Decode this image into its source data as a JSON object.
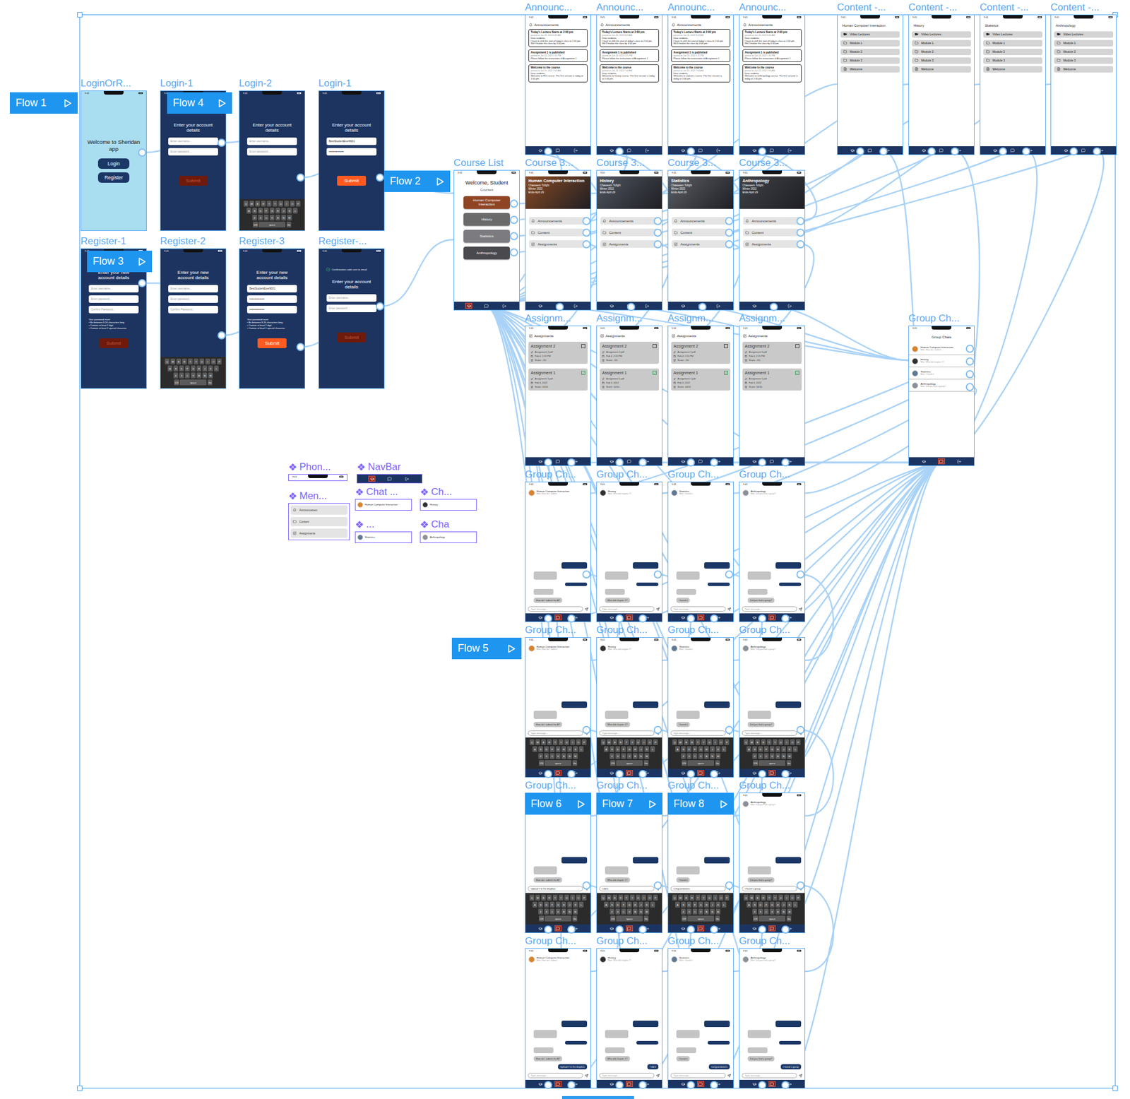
{
  "status_time": "9:41",
  "component_icon": "❖",
  "keyboard": {
    "rows": [
      [
        "Q",
        "W",
        "E",
        "R",
        "T",
        "Y",
        "U",
        "I",
        "O",
        "P"
      ],
      [
        "A",
        "S",
        "D",
        "F",
        "G",
        "H",
        "J",
        "K",
        "L"
      ],
      [
        "Z",
        "X",
        "C",
        "V",
        "B",
        "N",
        "M"
      ]
    ],
    "bottom": [
      "123",
      "space",
      "Go"
    ]
  },
  "login": [
    {
      "label": "LoginOrR...",
      "kind": "welcome",
      "title": "Welcome to Sheridan app",
      "buttons": [
        "Login",
        "Register"
      ]
    },
    {
      "label": "Login-1",
      "kind": "form",
      "note": null,
      "title": "Enter your account details",
      "fields": [
        {
          "text": "Enter username...",
          "filled": false
        },
        {
          "text": "Enter password...",
          "filled": false
        }
      ],
      "rules": null,
      "submit": {
        "label": "Submit",
        "enabled": false
      },
      "keyboard": false
    },
    {
      "label": "Login-2",
      "kind": "form",
      "note": null,
      "title": "Enter your account details",
      "fields": [
        {
          "text": "Enter username...",
          "filled": false
        },
        {
          "text": "Enter password...",
          "filled": false
        }
      ],
      "rules": null,
      "submit": null,
      "keyboard": true
    },
    {
      "label": "Login-1",
      "kind": "form",
      "note": null,
      "title": "Enter your account details",
      "fields": [
        {
          "text": "BestStudentEver9001",
          "filled": true
        },
        {
          "text": "••••••••••••••••",
          "filled": true
        }
      ],
      "rules": null,
      "submit": {
        "label": "Submit",
        "enabled": true
      },
      "keyboard": false
    }
  ],
  "register": [
    {
      "label": "Register-1",
      "kind": "form",
      "note": null,
      "title": "Enter your new account details",
      "fields": [
        {
          "text": "Enter username...",
          "filled": false
        },
        {
          "text": "Enter password...",
          "filled": false
        },
        {
          "text": "Confirm Password...",
          "filled": false
        }
      ],
      "rules": {
        "title": "Your password must:",
        "items": [
          "Be between 8-16 characters long",
          "Contain at least 1 digit",
          "Contain at least 1 special character"
        ]
      },
      "submit": {
        "label": "Submit",
        "enabled": false
      },
      "keyboard": false
    },
    {
      "label": "Register-2",
      "kind": "form",
      "note": null,
      "title": "Enter your new account details",
      "fields": [
        {
          "text": "Enter username...",
          "filled": false
        },
        {
          "text": "Enter password...",
          "filled": false
        },
        {
          "text": "Confirm Password...",
          "filled": false
        }
      ],
      "rules": null,
      "submit": null,
      "keyboard": true
    },
    {
      "label": "Register-3",
      "kind": "form",
      "note": null,
      "title": "Enter your new account details",
      "fields": [
        {
          "text": "BestStudentEver9001",
          "filled": true
        },
        {
          "text": "••••••••••••••••",
          "filled": true
        },
        {
          "text": "••••••••••••••••",
          "filled": true
        }
      ],
      "rules": {
        "title": "Your password must:",
        "items": [
          "Be between 8-16 characters long",
          "Contain at least 1 digit",
          "Contain at least 1 special character"
        ]
      },
      "submit": {
        "label": "Submit",
        "enabled": true
      },
      "keyboard": false
    },
    {
      "label": "Register-...",
      "kind": "form",
      "note": "Confirmation code sent to email",
      "title": "Enter your account details",
      "fields": [
        {
          "text": "Enter username...",
          "filled": false
        },
        {
          "text": "Enter password...",
          "filled": false
        }
      ],
      "rules": null,
      "submit": {
        "label": "Submit",
        "enabled": false
      },
      "keyboard": false
    }
  ],
  "course_list": {
    "label": "Course List",
    "title": "Welcome, Student",
    "subtitle": "Courses",
    "nav_selected": "courses",
    "courses": [
      {
        "name": "Human Computer Interaction",
        "color": "#8f4524"
      },
      {
        "name": "History",
        "color": "#6a6a6a"
      },
      {
        "name": "Statistics",
        "color": "#7b7b80"
      },
      {
        "name": "Anthropology",
        "color": "#4a4a4e"
      }
    ]
  },
  "courses": [
    {
      "label": "Course 3...",
      "title": "Human Computer Interaction",
      "teacher": "Chasseem Tofighi",
      "term": "Winter 2022",
      "ends": "Ends April 29",
      "color": "#8a4a22",
      "menu": [
        "Announcements",
        "Content",
        "Assignments"
      ]
    },
    {
      "label": "Course 3...",
      "title": "History",
      "teacher": "Chasseem Tofighi",
      "term": "Winter 2022",
      "ends": "Ends April 29",
      "color": "#4f5560",
      "menu": [
        "Announcements",
        "Content",
        "Assignments"
      ]
    },
    {
      "label": "Course 3...",
      "title": "Statistics",
      "teacher": "Chasseem Tofighi",
      "term": "Winter 2022",
      "ends": "Ends April 29",
      "color": "#5c5f66",
      "menu": [
        "Announcements",
        "Content",
        "Assignments"
      ]
    },
    {
      "label": "Course 3...",
      "title": "Anthropology",
      "teacher": "Chasseem Tofighi",
      "term": "Winter 2022",
      "ends": "Ends April 29",
      "color": "#3e4248",
      "menu": [
        "Announcements",
        "Content",
        "Assignments"
      ]
    }
  ],
  "announcements": [
    {
      "label": "Announc...",
      "title": "Announcements",
      "cards": [
        {
          "title": "Today's Lecture Starts at 2:00 pm",
          "date": "posted on Jan 26, 2022 8:42 AM",
          "body": "Dear students,\nI have to shift the start of today's class to 2:00 pm. We'll finalize the class by 4:00 pm."
        },
        {
          "title": "Assignment 1 is published",
          "date": "posted on Jan 24, 2022 1:15 PM",
          "body": "Please follow the instructions of Assignment 1"
        },
        {
          "title": "Welcome to the course",
          "date": "posted on Jan 20, 2022 7:00 AM",
          "body": "Dear students,\nWelcome to HCI course. The first session is today at 1:00 pm."
        }
      ]
    },
    {
      "label": "Announc...",
      "title": "Announcements",
      "cards": [
        {
          "title": "Today's Lecture Starts at 2:00 pm",
          "date": "posted on Jan 26, 2022 8:42 AM",
          "body": "Dear students,\nI have to shift the start of today's class to 2:00 pm. We'll finalize the class by 4:00 pm."
        },
        {
          "title": "Assignment 1 is published",
          "date": "posted on Jan 24, 2022 1:15 PM",
          "body": "Please follow the instructions of Assignment 1"
        },
        {
          "title": "Welcome to the course",
          "date": "posted on Jan 20, 2022 7:00 AM",
          "body": "Dear students,\nWelcome to history course. The first session is today at 1:00 pm."
        }
      ]
    },
    {
      "label": "Announc...",
      "title": "Announcements",
      "cards": [
        {
          "title": "Today's Lecture Starts at 2:00 pm",
          "date": "posted on Jan 26, 2022 8:42 AM",
          "body": "Dear students,\nI have to shift the start of today's class to 2:00 pm. We'll finalize the class by 4:00 pm."
        },
        {
          "title": "Assignment 1 is published",
          "date": "posted on Jan 24, 2022 1:15 PM",
          "body": "Please follow the instructions of Assignment 1"
        },
        {
          "title": "Welcome to the course",
          "date": "posted on Jan 20, 2022 7:00 AM",
          "body": "Dear students,\nWelcome to statistics course. The first session is today at 1:00 pm."
        }
      ]
    },
    {
      "label": "Announc...",
      "title": "Announcements",
      "cards": [
        {
          "title": "Today's Lecture Starts at 2:00 pm",
          "date": "posted on Jan 26, 2022 8:42 AM",
          "body": "Dear students,\nI have to shift the start of today's class to 2:00 pm. We'll finalize the class by 4:00 pm."
        },
        {
          "title": "Assignment 1 is published",
          "date": "posted on Jan 24, 2022 1:15 PM",
          "body": "Please follow the instructions of Assignment 1"
        },
        {
          "title": "Welcome to the course",
          "date": "posted on Jan 20, 2022 7:00 AM",
          "body": "Dear students,\nWelcome to anthropology course. The first session is today at 1:00 pm."
        }
      ]
    }
  ],
  "contents": [
    {
      "label": "Content -...",
      "title": "Human Computer Interaction",
      "items": [
        {
          "text": "Video Lectures",
          "kind": "video"
        },
        {
          "text": "Module 1",
          "kind": "folder"
        },
        {
          "text": "Module 2",
          "kind": "folder"
        },
        {
          "text": "Module 3",
          "kind": "folder"
        },
        {
          "text": "Welcome",
          "kind": "file"
        }
      ]
    },
    {
      "label": "Content -...",
      "title": "History",
      "items": [
        {
          "text": "Video Lectures",
          "kind": "video"
        },
        {
          "text": "Module 1",
          "kind": "folder"
        },
        {
          "text": "Module 2",
          "kind": "folder"
        },
        {
          "text": "Module 3",
          "kind": "folder"
        },
        {
          "text": "Welcome",
          "kind": "file"
        }
      ]
    },
    {
      "label": "Content -...",
      "title": "Statistics",
      "items": [
        {
          "text": "Video Lectures",
          "kind": "video"
        },
        {
          "text": "Module 1",
          "kind": "folder"
        },
        {
          "text": "Module 2",
          "kind": "folder"
        },
        {
          "text": "Module 3",
          "kind": "folder"
        },
        {
          "text": "Welcome",
          "kind": "file"
        }
      ]
    },
    {
      "label": "Content -...",
      "title": "Anthropology",
      "items": [
        {
          "text": "Video Lectures",
          "kind": "video"
        },
        {
          "text": "Module 1",
          "kind": "folder"
        },
        {
          "text": "Module 2",
          "kind": "folder"
        },
        {
          "text": "Module 3",
          "kind": "folder"
        },
        {
          "text": "Welcome",
          "kind": "file"
        }
      ]
    }
  ],
  "assignments": [
    {
      "label": "Assignm...",
      "title": "Assignments",
      "items": [
        {
          "name": "Assignment 2",
          "checked": false,
          "file": "Assignment 2.pdf",
          "due": "Feb 4, 2:15 PM",
          "score": "Score: -/10"
        },
        {
          "name": "Assignment 1",
          "checked": true,
          "file": "Assignment 1.pdf",
          "due": "Feb 3, 2022",
          "score": "Score: 10/10"
        }
      ]
    },
    {
      "label": "Assignm...",
      "title": "Assignments",
      "items": [
        {
          "name": "Assignment 2",
          "checked": false,
          "file": "Assignment 2.pdf",
          "due": "Feb 4, 2:15 PM",
          "score": "Score: -/10"
        },
        {
          "name": "Assignment 1",
          "checked": true,
          "file": "Assignment 1.pdf",
          "due": "Feb 3, 2022",
          "score": "Score: 10/10"
        }
      ]
    },
    {
      "label": "Assignm...",
      "title": "Assignments",
      "items": [
        {
          "name": "Assignment 2",
          "checked": false,
          "file": "Assignment 2.pdf",
          "due": "Feb 4, 2:15 PM",
          "score": "Score: -/10"
        },
        {
          "name": "Assignment 1",
          "checked": true,
          "file": "Assignment 1.pdf",
          "due": "Feb 3, 2022",
          "score": "Score: 10/10"
        }
      ]
    },
    {
      "label": "Assignm...",
      "title": "Assignments",
      "items": [
        {
          "name": "Assignment 2",
          "checked": false,
          "file": "Assignment 2.pdf",
          "due": "Feb 4, 2:15 PM",
          "score": "Score: -/10"
        },
        {
          "name": "Assignment 1",
          "checked": true,
          "file": "Assignment 1.pdf",
          "due": "Feb 3, 2022",
          "score": "Score: 10/10"
        }
      ]
    }
  ],
  "chat_rows": [
    [
      {
        "label": "Group Ch...",
        "course": "Human Computer Interaction",
        "preview": "Mon: How do I submit...",
        "color": "#d9822b",
        "question": "How do I submit the A?",
        "input": "Type message...",
        "input_filled": false,
        "sent": null,
        "keyboard": false
      },
      {
        "label": "Group Ch...",
        "course": "History",
        "preview": "Mon: Who did chapter 1?",
        "color": "#2f2f2f",
        "question": "Who did chapter 1?",
        "input": "Type message...",
        "input_filled": false,
        "sent": null,
        "keyboard": false
      },
      {
        "label": "Group Ch...",
        "course": "Statistics",
        "preview": "Mon: I found it",
        "color": "#5f7896",
        "question": "I found it",
        "input": "Type message...",
        "input_filled": false,
        "sent": null,
        "keyboard": false
      },
      {
        "label": "Group Ch...",
        "course": "Anthropology",
        "preview": "Mon: Did you find a group?",
        "color": "#8a9098",
        "question": "Did you find a group?",
        "input": "Type message...",
        "input_filled": false,
        "sent": null,
        "keyboard": false
      }
    ],
    [
      {
        "label": "Group Ch...",
        "course": "Human Computer Interaction",
        "preview": "Mon: How do I submit...",
        "color": "#d9822b",
        "question": "How do I submit the A?",
        "input": "Type message...",
        "input_filled": false,
        "sent": null,
        "keyboard": true
      },
      {
        "label": "Group Ch...",
        "course": "History",
        "preview": "Mon: Who did chapter 1?",
        "color": "#2f2f2f",
        "question": "Who did chapter 1?",
        "input": "Type message...",
        "input_filled": false,
        "sent": null,
        "keyboard": true
      },
      {
        "label": "Group Ch...",
        "course": "Statistics",
        "preview": "Mon: I found it",
        "color": "#5f7896",
        "question": "I found it",
        "input": "Type message...",
        "input_filled": false,
        "sent": null,
        "keyboard": true
      },
      {
        "label": "Group Ch...",
        "course": "Anthropology",
        "preview": "Mon: Did you find a group?",
        "color": "#8a9098",
        "question": "Did you find a group?",
        "input": "Type message...",
        "input_filled": false,
        "sent": null,
        "keyboard": true
      }
    ],
    [
      {
        "label": "Group Ch...",
        "course": "Human Computer Interaction",
        "preview": "Mon: How do I submit...",
        "color": "#d9822b",
        "question": "How do I submit the A?",
        "input": "Upload it to the dropbox",
        "input_filled": true,
        "sent": null,
        "keyboard": true
      },
      {
        "label": "Group Ch...",
        "course": "History",
        "preview": "Mon: Who did chapter 1?",
        "color": "#2f2f2f",
        "question": "Who did chapter 1?",
        "input": "I did it",
        "input_filled": true,
        "sent": null,
        "keyboard": true
      },
      {
        "label": "Group Ch...",
        "course": "Statistics",
        "preview": "Mon: I found it",
        "color": "#5f7896",
        "question": "I found it",
        "input": "Congratulations",
        "input_filled": true,
        "sent": null,
        "keyboard": true
      },
      {
        "label": "Group Ch...",
        "course": "Anthropology",
        "preview": "Mon: Did you find a group?",
        "color": "#8a9098",
        "question": "Did you find a group?",
        "input": "I found a group",
        "input_filled": true,
        "sent": null,
        "keyboard": true
      }
    ],
    [
      {
        "label": "Group Ch...",
        "course": "Human Computer Interaction",
        "preview": "Mon: How do I submit...",
        "color": "#d9822b",
        "question": "How do I submit the A?",
        "input": "Type message...",
        "input_filled": false,
        "sent": "Upload it to the dropbox",
        "keyboard": false
      },
      {
        "label": "Group Ch...",
        "course": "History",
        "preview": "Mon: Who did chapter 1?",
        "color": "#2f2f2f",
        "question": "Who did chapter 1?",
        "input": "Type message...",
        "input_filled": false,
        "sent": "I did it",
        "keyboard": false
      },
      {
        "label": "Group Ch...",
        "course": "Statistics",
        "preview": "Mon: I found it",
        "color": "#5f7896",
        "question": "I found it",
        "input": "Type message...",
        "input_filled": false,
        "sent": "Congratulations",
        "keyboard": false
      },
      {
        "label": "Group Ch...",
        "course": "Anthropology",
        "preview": "Mon: Did you find a group?",
        "color": "#8a9098",
        "question": "Did you find a group?",
        "input": "Type message...",
        "input_filled": false,
        "sent": "I found a group",
        "keyboard": false
      }
    ]
  ],
  "chat_list": {
    "label": "Group Ch...",
    "title": "Group Chats",
    "nav_selected": "chats",
    "items": [
      {
        "name": "Human Computer Interaction",
        "preview": "Mon: How do I submit...",
        "color": "#d9822b"
      },
      {
        "name": "History",
        "preview": "Mon: Who did chapter 1?",
        "color": "#2f2f2f"
      },
      {
        "name": "Statistics",
        "preview": "Mon: I found it",
        "color": "#5f7896"
      },
      {
        "name": "Anthropology",
        "preview": "Mon: Did you find a group?",
        "color": "#8a9098"
      }
    ]
  },
  "components": [
    {
      "label": "Phon...",
      "kind": "phone-bar"
    },
    {
      "label": "NavBar",
      "kind": "navbar"
    },
    {
      "label": "Men...",
      "kind": "menu",
      "items": [
        "Announcemen",
        "Content",
        "Assignments"
      ]
    },
    {
      "label": "Chat ...",
      "kind": "chat-item",
      "name": "Human Computer Interaction",
      "color": "#d9822b"
    },
    {
      "label": "Ch...",
      "kind": "chat-item",
      "name": "History",
      "color": "#2f2f2f"
    },
    {
      "label": "...",
      "kind": "chat-item",
      "name": "Statistics",
      "color": "#5f7896"
    },
    {
      "label": "Cha",
      "kind": "chat-item",
      "name": "Anthropology",
      "color": "#8a9098"
    }
  ],
  "flows": [
    {
      "label": "Flow 1"
    },
    {
      "label": "Flow 4"
    },
    {
      "label": "Flow 3"
    },
    {
      "label": "Flow 2"
    },
    {
      "label": "Flow 5"
    },
    {
      "label": "Flow 6"
    },
    {
      "label": "Flow 7"
    },
    {
      "label": "Flow 8"
    }
  ]
}
